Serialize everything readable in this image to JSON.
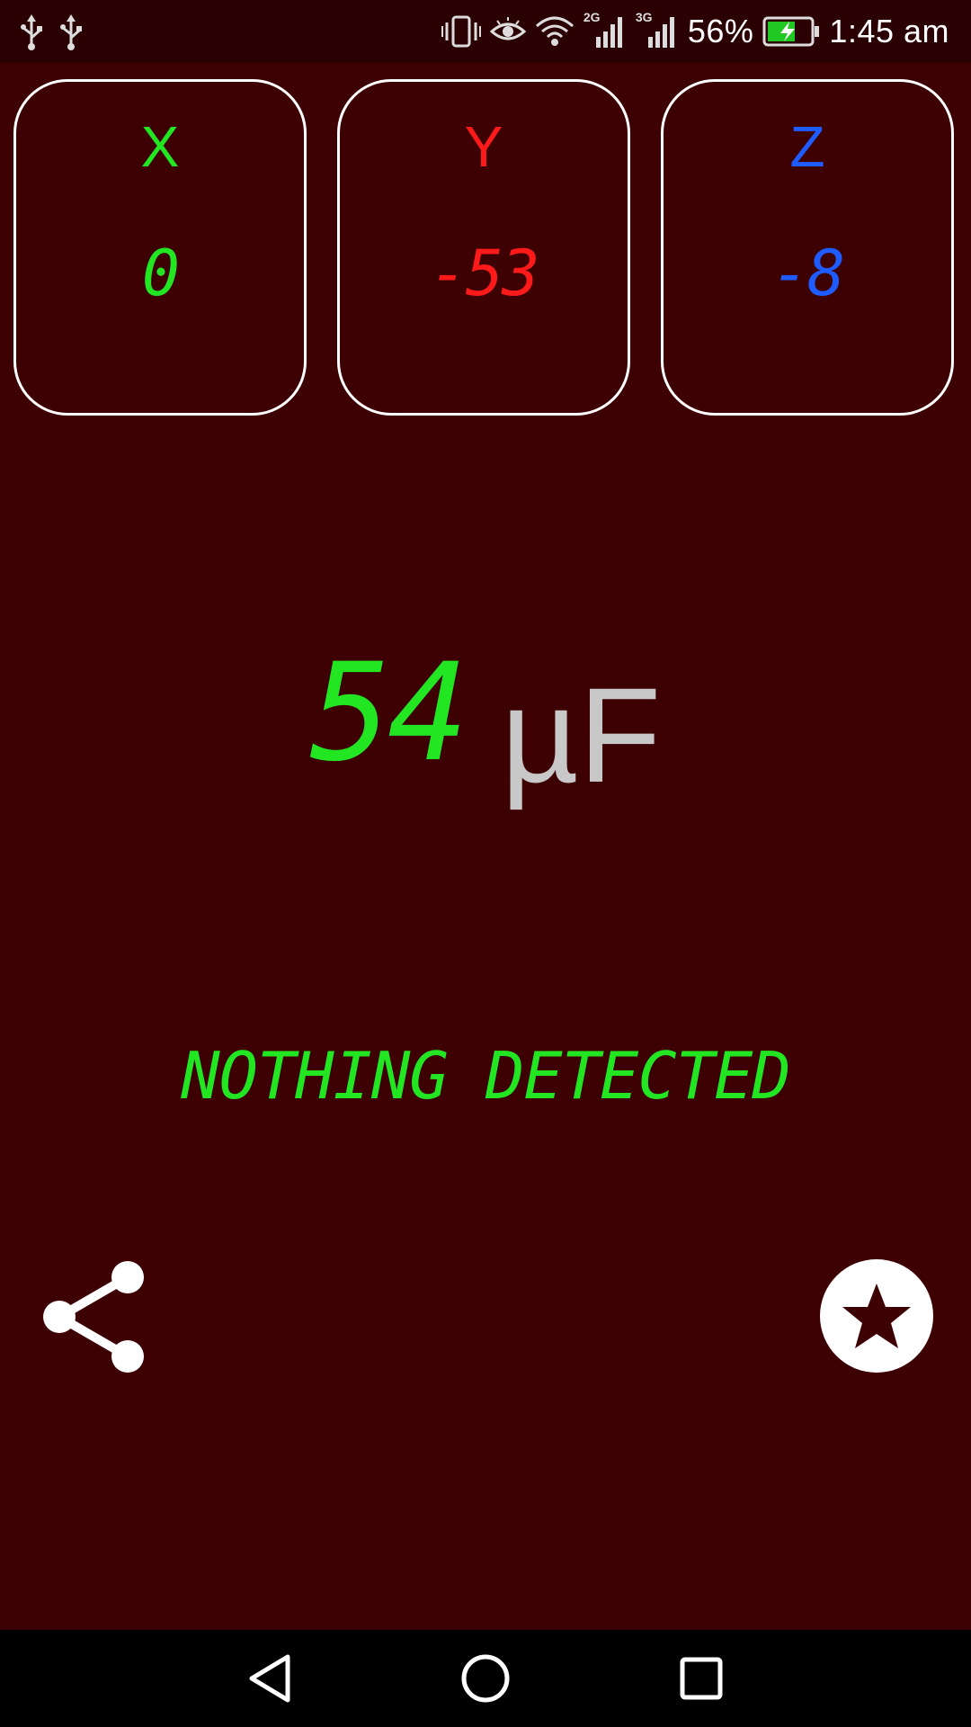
{
  "status_bar": {
    "battery_percent": "56%",
    "time": "1:45 am",
    "network_2g": "2G",
    "network_3g": "3G",
    "icons": [
      "usb-icon",
      "usb-icon",
      "vibrate-icon",
      "eye-icon",
      "wifi-icon",
      "signal-icon",
      "signal-icon",
      "battery-charging-icon"
    ]
  },
  "axes": [
    {
      "label": "X",
      "value": "0",
      "color": "#22e622"
    },
    {
      "label": "Y",
      "value": "-53",
      "color": "#ff1a1a"
    },
    {
      "label": "Z",
      "value": "-8",
      "color": "#1f5cff"
    }
  ],
  "reading": {
    "value": "54",
    "unit": "µF",
    "value_color": "#22e622"
  },
  "status_message": {
    "text": "NOTHING DETECTED",
    "color": "#22e622"
  },
  "actions": {
    "share_icon": "share-icon",
    "favorite_icon": "star-icon"
  },
  "nav_bar": {
    "icons": [
      "back-icon",
      "home-icon",
      "recents-icon"
    ]
  }
}
